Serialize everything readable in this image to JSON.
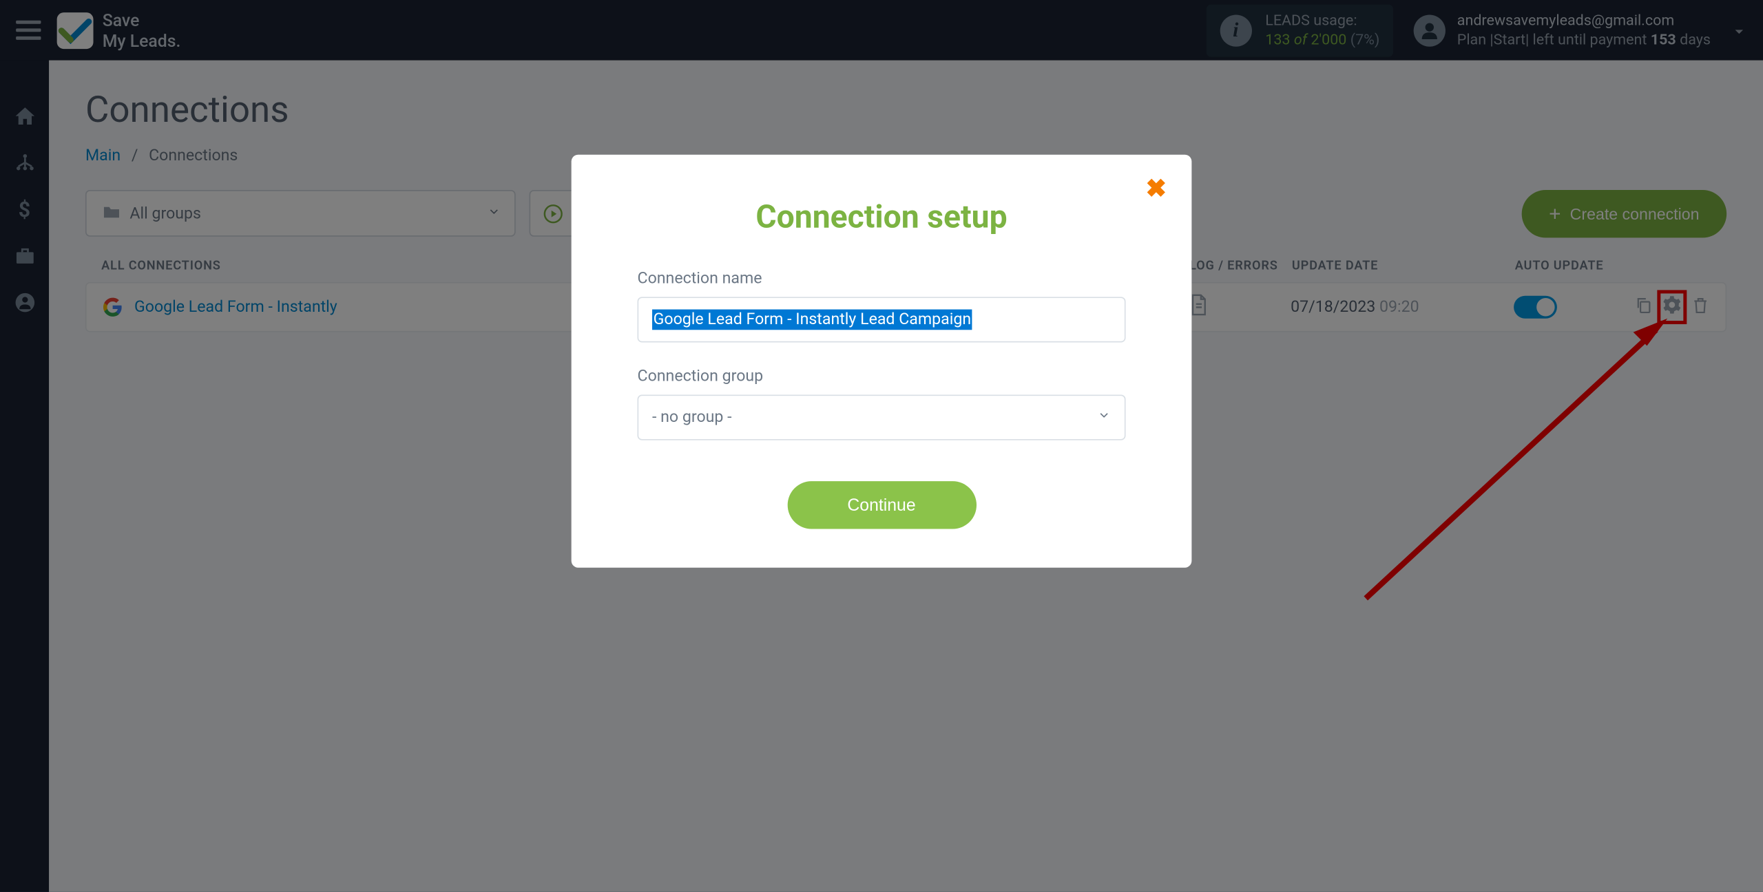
{
  "header": {
    "logo_line1": "Save",
    "logo_line2": "My Leads.",
    "leads": {
      "label": "LEADS usage:",
      "current": "133",
      "of": "of",
      "max": "2'000",
      "pct": "(7%)"
    },
    "user": {
      "email": "andrewsavemyleads@gmail.com",
      "plan_prefix": "Plan |Start| left until payment ",
      "days_num": "153",
      "days_label": " days"
    }
  },
  "page": {
    "title": "Connections",
    "breadcrumb_main": "Main",
    "breadcrumb_current": "Connections",
    "group_filter": "All groups",
    "create_button": "Create connection",
    "col_all": "ALL CONNECTIONS",
    "col_log": "LOG / ERRORS",
    "col_date": "UPDATE DATE",
    "col_auto": "AUTO UPDATE"
  },
  "connection": {
    "name": "Google Lead Form - Instantly",
    "date": "07/18/2023",
    "time": "09:20"
  },
  "modal": {
    "title": "Connection setup",
    "label_name": "Connection name",
    "input_value": "Google Lead Form - Instantly Lead Campaign",
    "label_group": "Connection group",
    "group_value": "- no group -",
    "continue": "Continue"
  }
}
